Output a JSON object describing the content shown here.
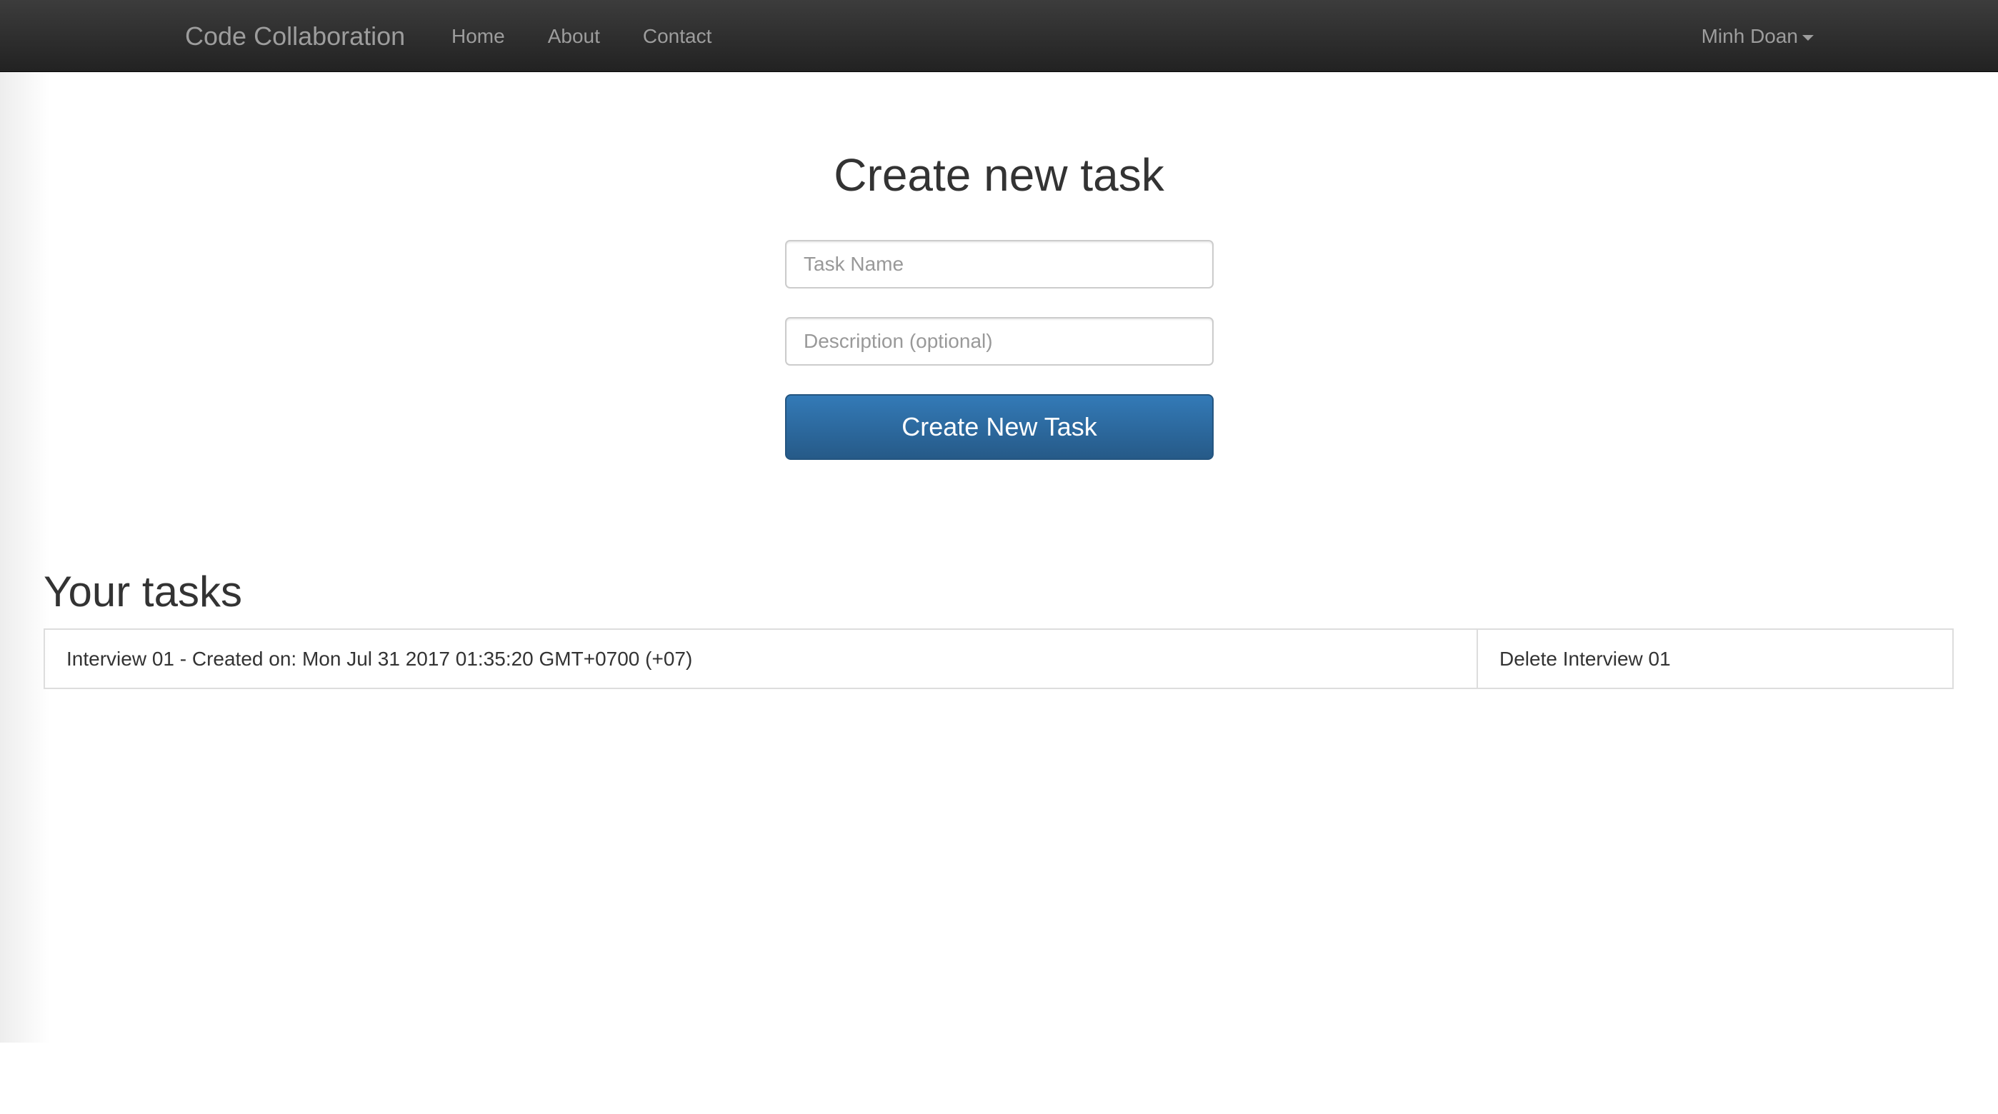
{
  "navbar": {
    "brand": "Code Collaboration",
    "links": [
      {
        "label": "Home"
      },
      {
        "label": "About"
      },
      {
        "label": "Contact"
      }
    ],
    "user": "Minh Doan"
  },
  "create_form": {
    "title": "Create new task",
    "task_name_placeholder": "Task Name",
    "description_placeholder": "Description (optional)",
    "submit_label": "Create New Task"
  },
  "tasks": {
    "title": "Your tasks",
    "rows": [
      {
        "info": "Interview 01 - Created on: Mon Jul 31 2017 01:35:20 GMT+0700 (+07)",
        "delete_label": "Delete Interview 01"
      }
    ]
  },
  "colors": {
    "navbar_top": "#3c3c3c",
    "navbar_bottom": "#222222",
    "nav_text": "#9d9d9d",
    "primary_button": "#337ab7",
    "border": "#dddddd"
  }
}
